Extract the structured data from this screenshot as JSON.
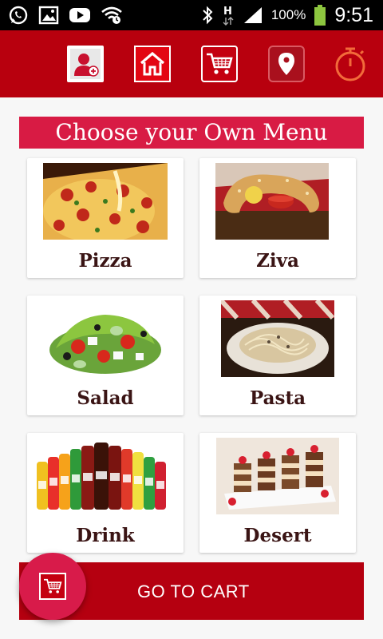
{
  "status_bar": {
    "battery_text": "100%",
    "time": "9:51",
    "icons": [
      "whatsapp-icon",
      "gallery-icon",
      "youtube-icon",
      "wifi-icon",
      "bluetooth-icon",
      "h-data-icon",
      "signal-icon",
      "battery-icon"
    ]
  },
  "nav": {
    "items": [
      {
        "name": "profile",
        "icon": "user-icon"
      },
      {
        "name": "home",
        "icon": "home-icon"
      },
      {
        "name": "cart",
        "icon": "cart-icon"
      },
      {
        "name": "location",
        "icon": "location-pin-icon"
      },
      {
        "name": "timer",
        "icon": "stopwatch-icon"
      }
    ]
  },
  "menu": {
    "title": "Choose your Own Menu",
    "items": [
      {
        "label": "Pizza"
      },
      {
        "label": "Ziva"
      },
      {
        "label": "Salad"
      },
      {
        "label": "Pasta"
      },
      {
        "label": "Drink"
      },
      {
        "label": "Desert"
      }
    ]
  },
  "cart_bar": {
    "label": "GO TO CART"
  },
  "colors": {
    "brand_red": "#b8000e",
    "title_pink": "#d81b44",
    "label_text": "#3a1414"
  }
}
